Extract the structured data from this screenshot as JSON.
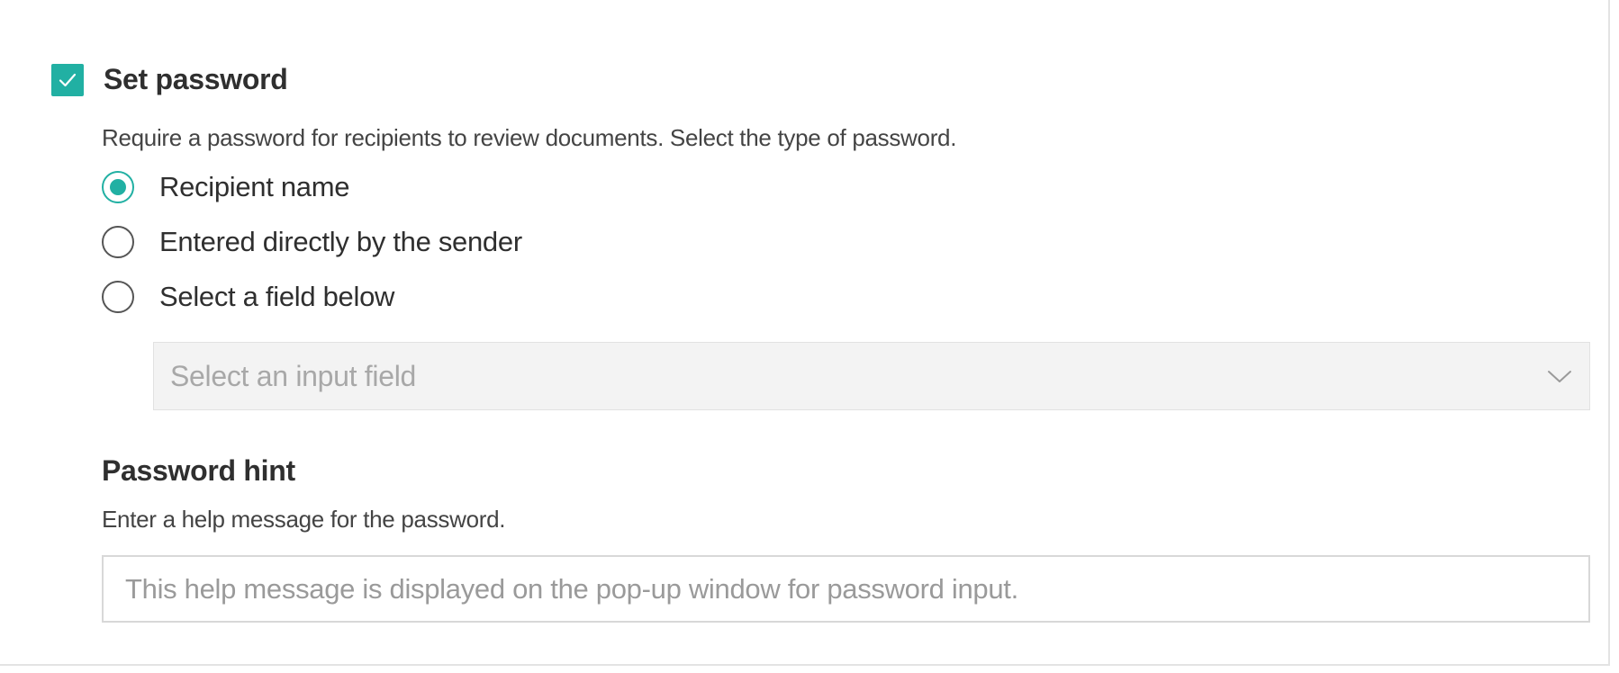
{
  "set_password": {
    "label": "Set password",
    "checked": true,
    "description": "Require a password for recipients to review documents. Select the type of password."
  },
  "password_type": {
    "options": [
      {
        "label": "Recipient name",
        "selected": true
      },
      {
        "label": "Entered directly by the sender",
        "selected": false
      },
      {
        "label": "Select a field below",
        "selected": false
      }
    ]
  },
  "input_field_select": {
    "placeholder": "Select an input field"
  },
  "password_hint": {
    "title": "Password hint",
    "description": "Enter a help message for the password.",
    "placeholder": "This help message is displayed on the pop-up window for password input.",
    "value": ""
  },
  "colors": {
    "accent": "#21b0a3"
  },
  "icons": {
    "checkbox": "check-icon",
    "select": "chevron-down-icon"
  }
}
